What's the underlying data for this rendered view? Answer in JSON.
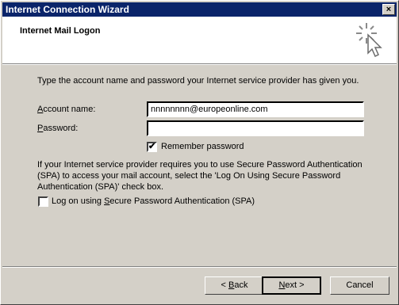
{
  "window": {
    "title": "Internet Connection Wizard",
    "close_glyph": "×"
  },
  "header": {
    "title": "Internet Mail Logon",
    "icon": "wizard-sparkle-cursor-icon"
  },
  "intro_text": "Type the account name and password your Internet service provider has given you.",
  "account": {
    "label_prefix": "A",
    "label_rest": "ccount name:",
    "value": "nnnnnnnn@europeonline.com"
  },
  "password": {
    "label_prefix": "P",
    "label_rest": "assword:",
    "value": ""
  },
  "remember": {
    "label": "Remember password",
    "checked": true,
    "check_glyph": "✔"
  },
  "spa_info": "If your Internet service provider requires you to use Secure Password Authentication (SPA) to access your mail account, select the 'Log On Using Secure Password Authentication (SPA)' check box.",
  "spa": {
    "label_a": "Log on using ",
    "label_u": "S",
    "label_b": "ecure Password Authentication (SPA)",
    "checked": false
  },
  "buttons": {
    "back": {
      "arrow": "< ",
      "u": "B",
      "rest": "ack"
    },
    "next": {
      "u": "N",
      "rest": "ext >"
    },
    "cancel": "Cancel"
  }
}
